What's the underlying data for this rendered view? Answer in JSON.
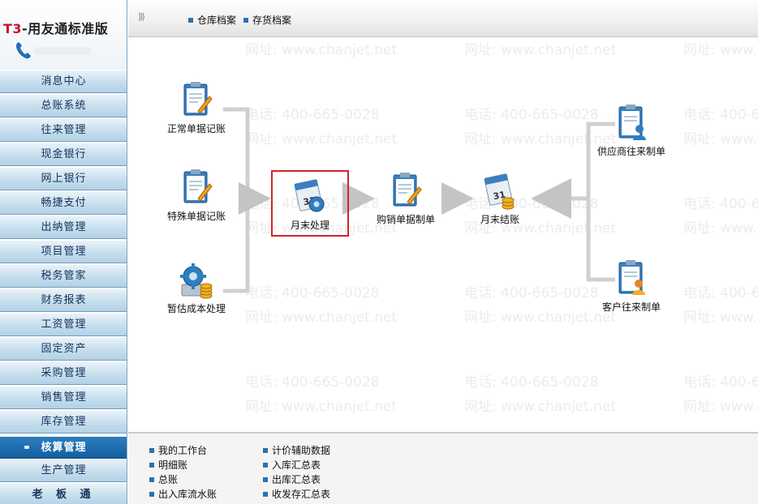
{
  "brand": {
    "prefix": "T3",
    "title": "-用友通标准版"
  },
  "sidebar": {
    "items": [
      {
        "label": "消息中心"
      },
      {
        "label": "总账系统"
      },
      {
        "label": "往来管理"
      },
      {
        "label": "现金银行"
      },
      {
        "label": "网上银行"
      },
      {
        "label": "畅捷支付"
      },
      {
        "label": "出纳管理"
      },
      {
        "label": "项目管理"
      },
      {
        "label": "税务管家"
      },
      {
        "label": "财务报表"
      },
      {
        "label": "工资管理"
      },
      {
        "label": "固定资产"
      },
      {
        "label": "采购管理"
      },
      {
        "label": "销售管理"
      },
      {
        "label": "库存管理"
      },
      {
        "label": "核算管理",
        "active": true
      },
      {
        "label": "生产管理"
      },
      {
        "label": "老 板 通"
      }
    ]
  },
  "topbar": {
    "expand_icon": "double-chevron-right-icon",
    "links": [
      {
        "label": "仓库档案"
      },
      {
        "label": "存货档案"
      }
    ]
  },
  "watermark": {
    "phone": "电话: 400-665-0028",
    "site": "网址: www.chanjet.net"
  },
  "flow": {
    "nodes": [
      {
        "id": "normal",
        "label": "正常单据记账",
        "icon": "clipboard-pen-icon"
      },
      {
        "id": "special",
        "label": "特殊单据记账",
        "icon": "clipboard-pen-icon"
      },
      {
        "id": "estimate",
        "label": "暂估成本处理",
        "icon": "gear-coins-icon"
      },
      {
        "id": "monthend",
        "label": "月末处理",
        "icon": "calendar-gear-icon",
        "highlight": true
      },
      {
        "id": "purchase",
        "label": "购销单据制单",
        "icon": "clipboard-pen-icon"
      },
      {
        "id": "close",
        "label": "月末结账",
        "icon": "calendar-coins-icon"
      },
      {
        "id": "supplier",
        "label": "供应商往来制单",
        "icon": "clipboard-person-icon"
      },
      {
        "id": "customer",
        "label": "客户往来制单",
        "icon": "clipboard-person-coins-icon"
      }
    ],
    "highlight_color": "#d2252b"
  },
  "bottom": {
    "col1": [
      {
        "label": "我的工作台"
      },
      {
        "label": "明细账"
      },
      {
        "label": "总账"
      },
      {
        "label": "出入库流水账"
      }
    ],
    "col2": [
      {
        "label": "计价辅助数据"
      },
      {
        "label": "入库汇总表"
      },
      {
        "label": "出库汇总表"
      },
      {
        "label": "收发存汇总表"
      }
    ]
  },
  "colors": {
    "accent": "#135e9e",
    "nav_bg": "#c6deed",
    "brand_red": "#c8102e"
  }
}
